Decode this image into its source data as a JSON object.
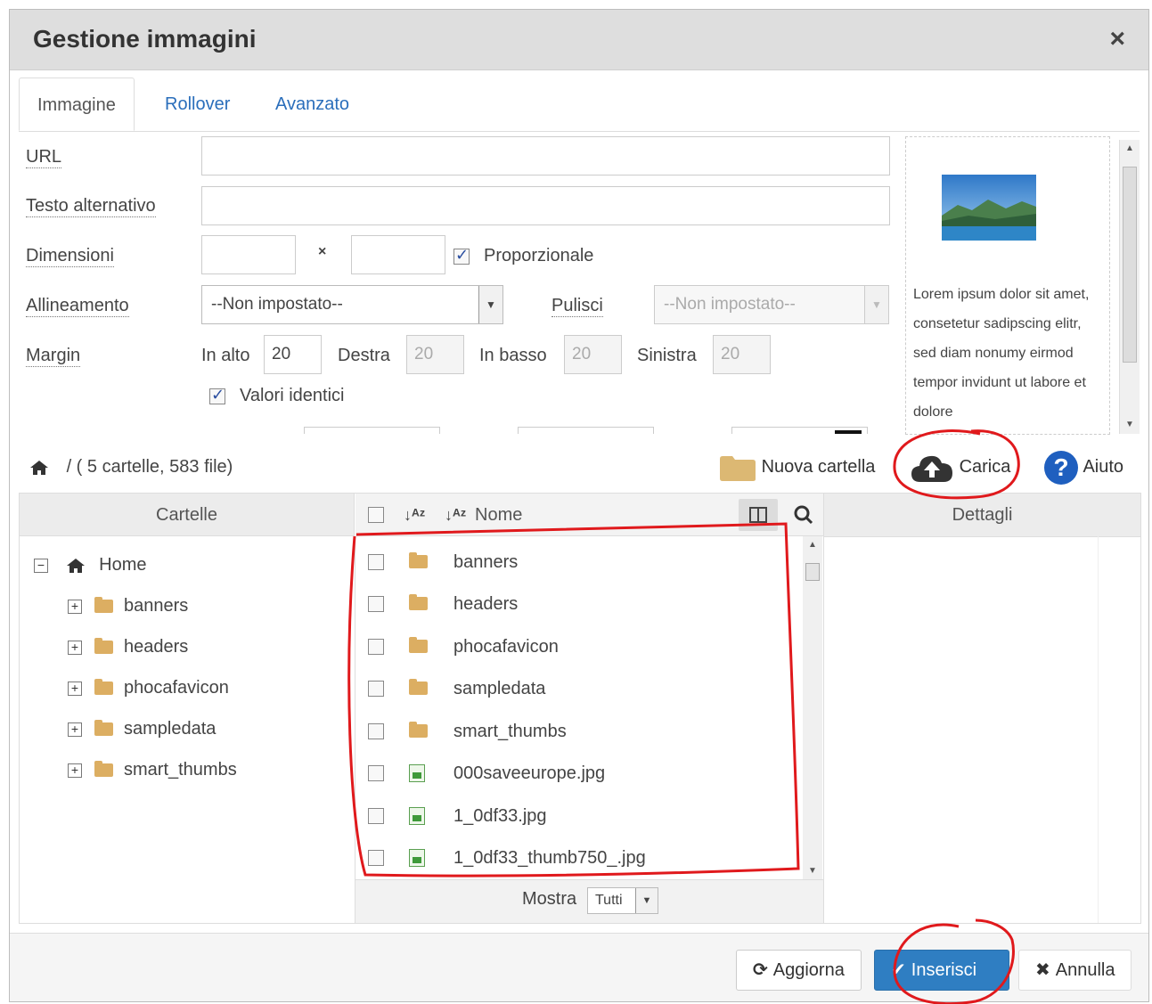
{
  "dialog": {
    "title": "Gestione immagini",
    "close_glyph": "×"
  },
  "tabs": [
    {
      "label": "Immagine",
      "active": true
    },
    {
      "label": "Rollover",
      "active": false
    },
    {
      "label": "Avanzato",
      "active": false
    }
  ],
  "form": {
    "url_label": "URL",
    "url_value": "",
    "alt_label": "Testo alternativo",
    "alt_value": "",
    "dimensions_label": "Dimensioni",
    "dimensions_separator": "×",
    "width_value": "",
    "height_value": "",
    "proportional_label": "Proporzionale",
    "proportional_checked": true,
    "alignment_label": "Allineamento",
    "alignment_value": "--Non impostato--",
    "clear_label": "Pulisci",
    "clear_value": "--Non impostato--",
    "margin_label": "Margin",
    "margin_top_label": "In alto",
    "margin_top_value": "20",
    "margin_right_label": "Destra",
    "margin_right_value": "20",
    "margin_bottom_label": "In basso",
    "margin_bottom_value": "20",
    "margin_left_label": "Sinistra",
    "margin_left_value": "20",
    "equal_values_label": "Valori identici",
    "equal_values_checked": true
  },
  "preview": {
    "text": "Lorem ipsum dolor sit amet, consetetur sadipscing elitr, sed diam nonumy eirmod tempor invidunt ut labore et dolore"
  },
  "browser": {
    "path": "/ ( 5 cartelle, 583 file)",
    "new_folder_label": "Nuova cartella",
    "upload_label": "Carica",
    "help_label": "Aiuto",
    "folders_header": "Cartelle",
    "name_header": "Nome",
    "details_header": "Dettagli",
    "tree": [
      {
        "label": "Home",
        "root": true
      },
      {
        "label": "banners"
      },
      {
        "label": "headers"
      },
      {
        "label": "phocafavicon"
      },
      {
        "label": "sampledata"
      },
      {
        "label": "smart_thumbs"
      }
    ],
    "files": [
      {
        "name": "banners",
        "type": "folder"
      },
      {
        "name": "headers",
        "type": "folder"
      },
      {
        "name": "phocafavicon",
        "type": "folder"
      },
      {
        "name": "sampledata",
        "type": "folder"
      },
      {
        "name": "smart_thumbs",
        "type": "folder"
      },
      {
        "name": "000saveeurope.jpg",
        "type": "image"
      },
      {
        "name": "1_0df33.jpg",
        "type": "image"
      },
      {
        "name": "1_0df33_thumb750_.jpg",
        "type": "image"
      }
    ],
    "show_label": "Mostra",
    "show_value": "Tutti"
  },
  "footer": {
    "refresh_label": "Aggiorna",
    "insert_label": "Inserisci",
    "cancel_label": "Annulla"
  },
  "colors": {
    "primary": "#2f7ec2",
    "link": "#2a6ebb",
    "annotation": "#e0191c",
    "folder": "#dcae62"
  }
}
